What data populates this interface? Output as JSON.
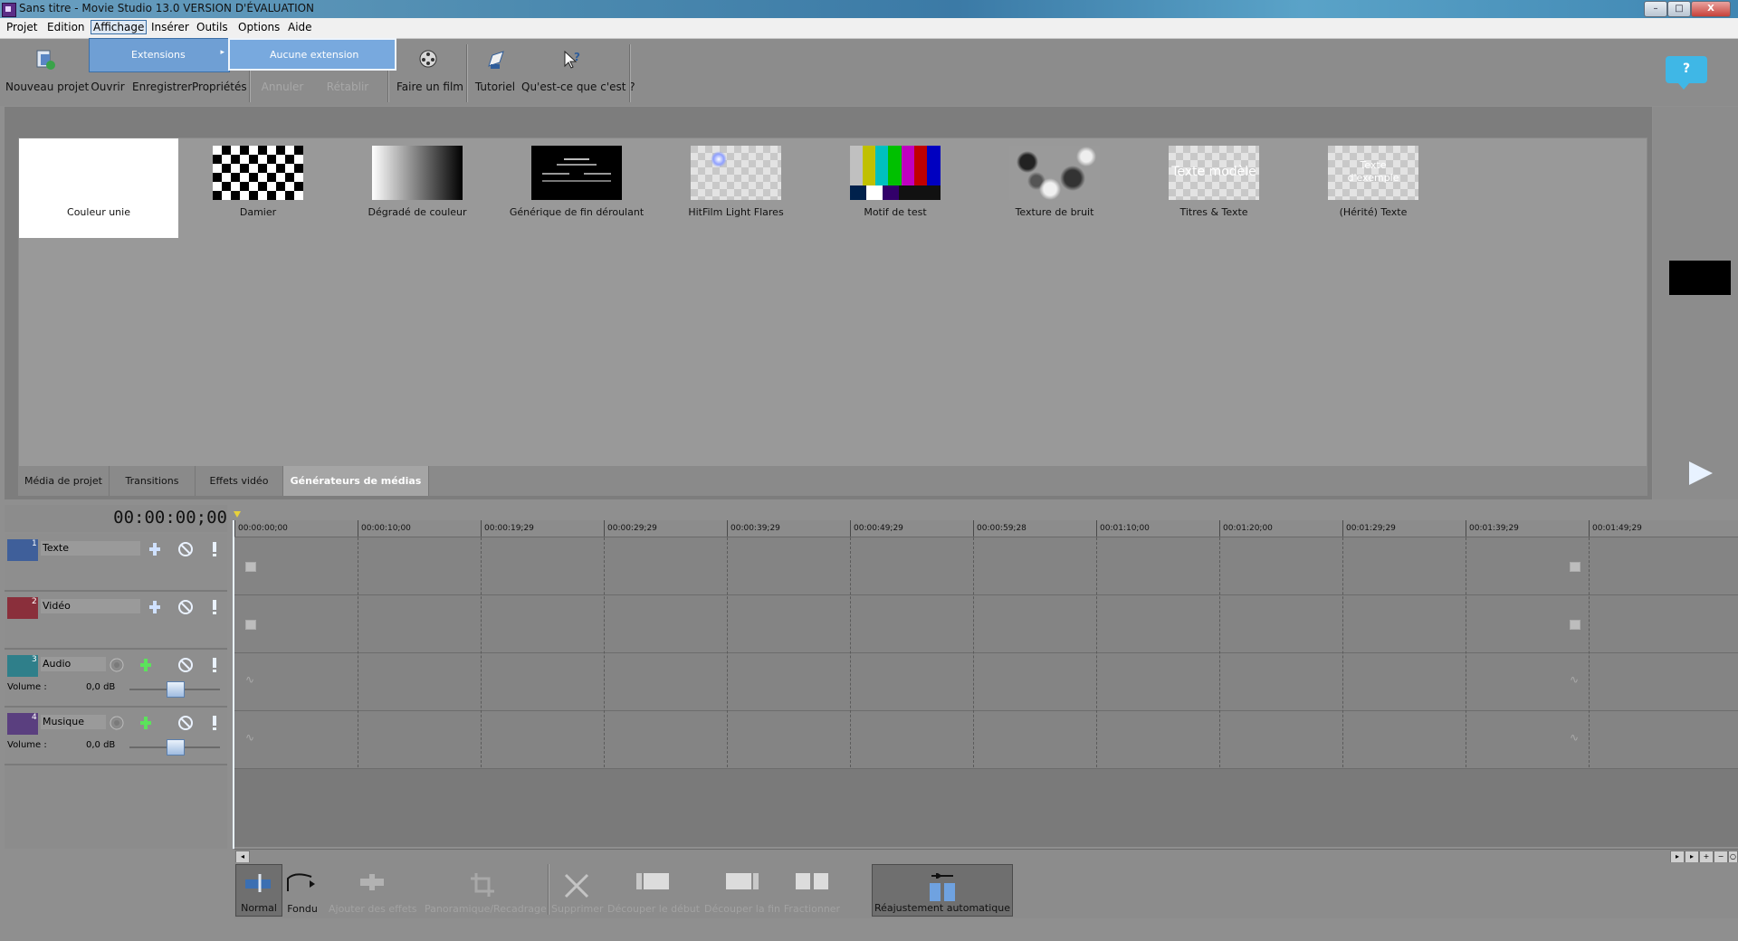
{
  "window": {
    "title": "Sans titre - Movie Studio 13.0 VERSION D'ÉVALUATION",
    "min": "–",
    "max": "□",
    "close": "X"
  },
  "menubar": {
    "items": [
      {
        "label": "Projet"
      },
      {
        "label": "Edition"
      },
      {
        "label": "Affichage",
        "active": true
      },
      {
        "label": "Insérer"
      },
      {
        "label": "Outils"
      },
      {
        "label": "Options"
      },
      {
        "label": "Aide"
      }
    ]
  },
  "dropdown": {
    "extensions": "Extensions",
    "submenu_item": "Aucune extension",
    "arrow": "▸"
  },
  "toolbar": {
    "new_project": "Nouveau projet",
    "open": "Ouvrir",
    "save": "Enregistrer",
    "properties": "Propriétés",
    "undo": "Annuler",
    "redo": "Rétablir",
    "make_movie": "Faire un film",
    "tutorial": "Tutoriel",
    "whats_this": "Qu'est-ce que c'est ?",
    "help_bubble": "?"
  },
  "generators": [
    {
      "name": "Couleur unie",
      "selected": true
    },
    {
      "name": "Damier"
    },
    {
      "name": "Dégradé de couleur"
    },
    {
      "name": "Générique de fin déroulant"
    },
    {
      "name": "HitFilm Light Flares"
    },
    {
      "name": "Motif de test"
    },
    {
      "name": "Texture de bruit"
    },
    {
      "name": "Titres & Texte",
      "overlay": "Texte modèle"
    },
    {
      "name": "(Hérité) Texte",
      "overlay": "Texte d'exemple"
    }
  ],
  "tabs": [
    {
      "label": "Média de projet"
    },
    {
      "label": "Transitions"
    },
    {
      "label": "Effets vidéo"
    },
    {
      "label": "Générateurs de médias",
      "active": true
    }
  ],
  "timeline": {
    "timecode": "00:00:00;00",
    "ruler": [
      "00:00:00;00",
      "00:00:10;00",
      "00:00:19;29",
      "00:00:29;29",
      "00:00:39;29",
      "00:00:49;29",
      "00:00:59;28",
      "00:01:10;00",
      "00:01:20;00",
      "00:01:29;29",
      "00:01:39;29",
      "00:01:49;29"
    ],
    "tracks": [
      {
        "num": "1",
        "name": "Texte",
        "type": "video",
        "color": "#3f5f9a"
      },
      {
        "num": "2",
        "name": "Vidéo",
        "type": "video",
        "color": "#8a2f3b"
      },
      {
        "num": "3",
        "name": "Audio",
        "type": "audio",
        "color": "#2f7f8a",
        "volume_label": "Volume :",
        "volume_value": "0,0 dB",
        "volume_level": 0.5
      },
      {
        "num": "4",
        "name": "Musique",
        "type": "audio",
        "color": "#5a3f7f",
        "volume_label": "Volume :",
        "volume_value": "0,0 dB",
        "volume_level": 0.5
      }
    ]
  },
  "edit_tools": [
    {
      "label": "Normal",
      "pressed": true
    },
    {
      "label": "Fondu"
    },
    {
      "label": "Ajouter des effets",
      "disabled": true
    },
    {
      "label": "Panoramique/Recadrage",
      "disabled": true
    },
    {
      "label": "Supprimer",
      "disabled": true
    },
    {
      "label": "Découper le début",
      "disabled": true
    },
    {
      "label": "Découper la fin",
      "disabled": true
    },
    {
      "label": "Fractionner",
      "disabled": true
    },
    {
      "label": "Réajustement automatique",
      "pressed": true
    }
  ],
  "colors": {
    "accent": "#6f9fd4",
    "help": "#3fb7e6"
  }
}
